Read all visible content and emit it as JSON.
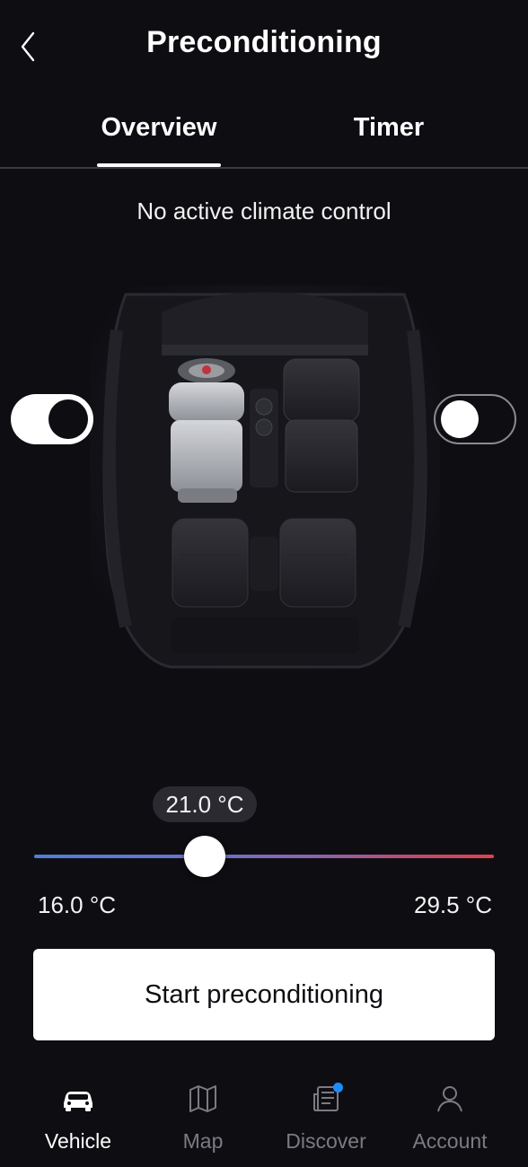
{
  "header": {
    "title": "Preconditioning",
    "back_icon": "chevron-left-icon"
  },
  "tabs": [
    {
      "label": "Overview",
      "active": true
    },
    {
      "label": "Timer",
      "active": false
    }
  ],
  "status": {
    "text": "No active climate control"
  },
  "zones": {
    "driver_seat_toggle": {
      "on": true
    },
    "passenger_seat_toggle": {
      "on": false
    }
  },
  "temperature": {
    "current": "21.0 °C",
    "min": "16.0 °C",
    "max": "29.5 °C",
    "value": 21.0,
    "range": [
      16.0,
      29.5
    ]
  },
  "actions": {
    "start_label": "Start preconditioning"
  },
  "bottom_nav": [
    {
      "label": "Vehicle",
      "icon": "car-icon",
      "active": true
    },
    {
      "label": "Map",
      "icon": "map-icon",
      "active": false
    },
    {
      "label": "Discover",
      "icon": "news-icon",
      "active": false,
      "badge": true
    },
    {
      "label": "Account",
      "icon": "user-icon",
      "active": false
    }
  ],
  "colors": {
    "background": "#0e0e12",
    "slider_cold": "#4f7fd6",
    "slider_hot": "#e0414f",
    "badge": "#1e8bff"
  }
}
